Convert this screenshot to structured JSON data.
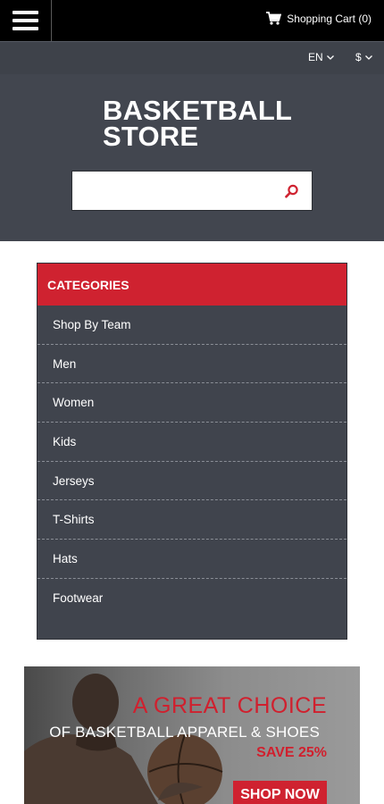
{
  "topbar": {
    "cart_label": "Shopping Cart (0)"
  },
  "settings": {
    "language": "EN",
    "currency": "$"
  },
  "header": {
    "logo_line1": "BASKETBALL",
    "logo_line2": "STORE",
    "search": {
      "value": "",
      "placeholder": ""
    }
  },
  "categories": {
    "title": "CATEGORIES",
    "items": [
      "Shop By Team",
      "Men",
      "Women",
      "Kids",
      "Jerseys",
      "T-Shirts",
      "Hats",
      "Footwear"
    ]
  },
  "banner": {
    "line1": "A GREAT CHOICE",
    "line2": "OF BASKETBALL APPAREL & SHOES",
    "line3": "SAVE 25%",
    "button": "SHOP NOW"
  },
  "colors": {
    "accent": "#cf2230",
    "header_bg": "#42464f",
    "topbar_bg": "#000000"
  },
  "icons": [
    "hamburger-menu-icon",
    "cart-icon",
    "chevron-down-icon",
    "search-icon"
  ]
}
